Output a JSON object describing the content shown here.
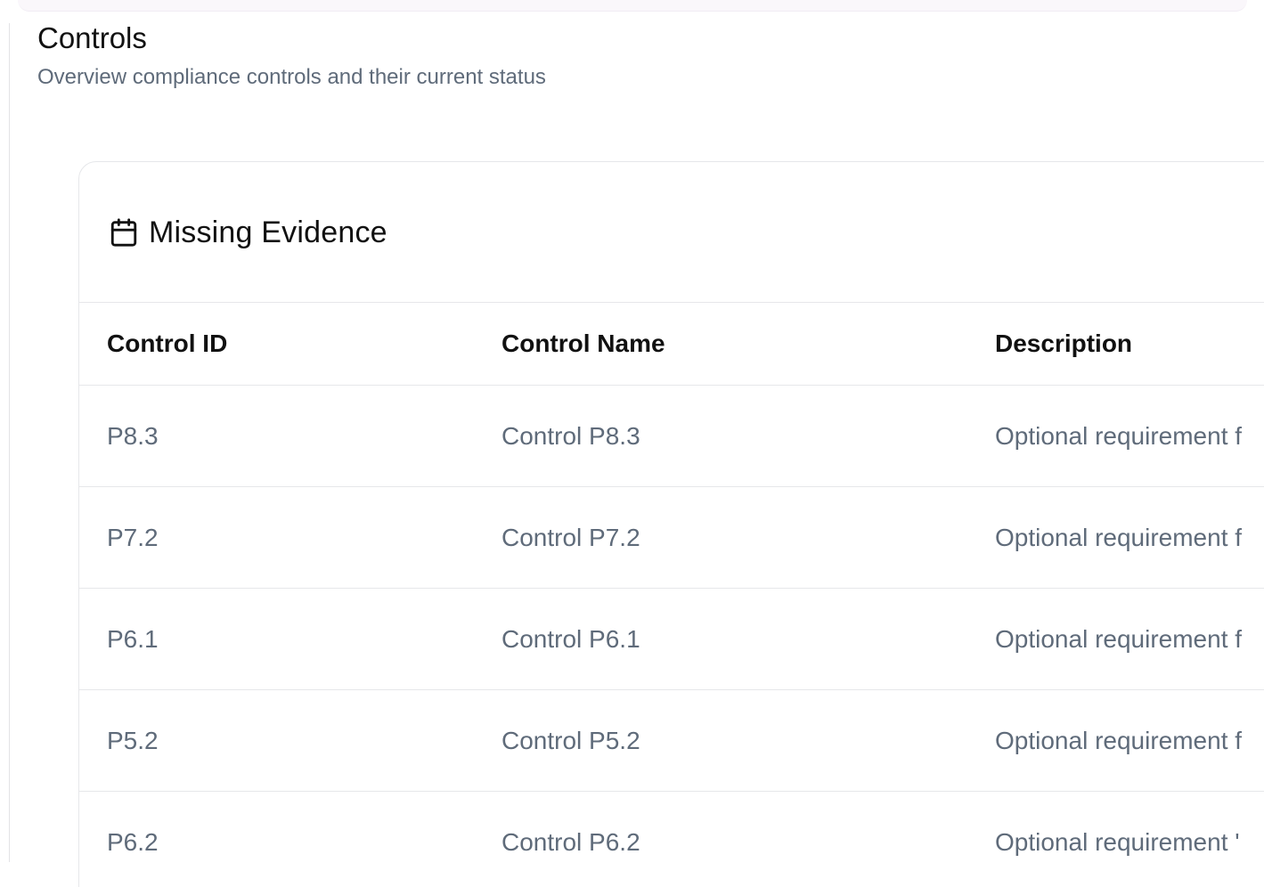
{
  "page": {
    "title": "Controls",
    "subtitle": "Overview compliance controls and their current status"
  },
  "card": {
    "icon": "calendar-icon",
    "title": "Missing Evidence"
  },
  "table": {
    "columns": [
      "Control ID",
      "Control Name",
      "Description"
    ],
    "rows": [
      {
        "id": "P8.3",
        "name": "Control P8.3",
        "description": "Optional requirement f"
      },
      {
        "id": "P7.2",
        "name": "Control P7.2",
        "description": "Optional requirement f"
      },
      {
        "id": "P6.1",
        "name": "Control P6.1",
        "description": "Optional requirement f"
      },
      {
        "id": "P5.2",
        "name": "Control P5.2",
        "description": "Optional requirement f"
      },
      {
        "id": "P6.2",
        "name": "Control P6.2",
        "description": "Optional requirement '"
      }
    ]
  },
  "colors": {
    "title": "#111111",
    "muted_text": "#5f6b7a",
    "border": "#e6e7ea"
  }
}
